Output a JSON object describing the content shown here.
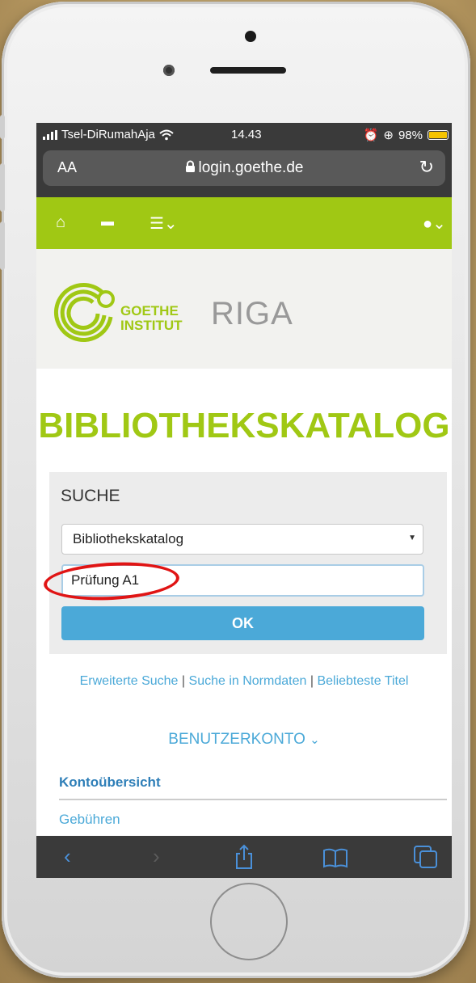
{
  "status_bar": {
    "carrier": "Tsel-DiRumahAja",
    "time": "14.43",
    "battery": "98%"
  },
  "browser": {
    "text_size_label": "AA",
    "url": "login.goethe.de",
    "reload_icon": "reload-icon"
  },
  "nav": {
    "home_icon": "home-icon",
    "cart_icon": "cart-icon",
    "menu_icon": "list-menu-icon",
    "user_icon": "user-icon"
  },
  "header": {
    "logo_line1": "GOETHE",
    "logo_line2": "INSTITUT",
    "location": "RIGA"
  },
  "page": {
    "title": "BIBLIOTHEKSKATALOG"
  },
  "search": {
    "section_label": "SUCHE",
    "catalog_select": "Bibliothekskatalog",
    "query_value": "Prüfung A1",
    "submit_label": "OK"
  },
  "links": {
    "advanced": "Erweiterte Suche",
    "authority": "Suche in Normdaten",
    "popular": "Beliebteste Titel"
  },
  "account": {
    "heading": "BENUTZERKONTO",
    "overview": "Kontoübersicht",
    "fees": "Gebühren"
  },
  "colors": {
    "brand_green": "#a0c814",
    "link_blue": "#4ba9d8",
    "highlight_red": "#e01414"
  }
}
